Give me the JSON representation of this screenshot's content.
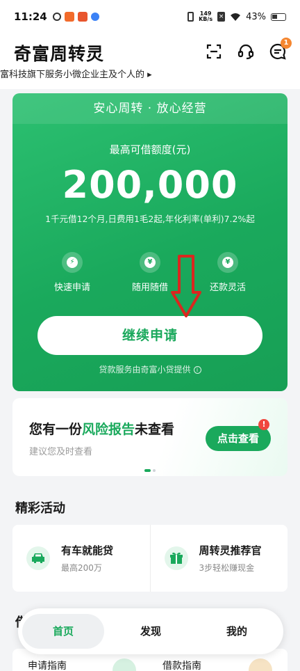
{
  "status_bar": {
    "time": "11:24",
    "net_speed_value": "149",
    "net_speed_unit": "KB/s",
    "battery": "43%"
  },
  "header": {
    "title": "奇富周转灵",
    "subtitle": "富科技旗下服务小微企业主及个人的 ▸",
    "notification_count": "1",
    "icons": [
      "scan-icon",
      "customer-service-icon",
      "message-icon"
    ]
  },
  "loan_card": {
    "slogan": "安心周转 · 放心经营",
    "limit_label": "最高可借额度(元)",
    "limit_amount": "200,000",
    "rate_text": "1千元借12个月,日费用1毛2起,年化利率(单利)7.2%起",
    "features": [
      {
        "label": "快速申请",
        "icon": "lightning-icon"
      },
      {
        "label": "随用随借",
        "icon": "wallet-icon"
      },
      {
        "label": "还款灵活",
        "icon": "money-bag-icon"
      }
    ],
    "continue_button": "继续申请",
    "provider_note": "贷款服务由奇富小贷提供"
  },
  "risk_card": {
    "title_prefix": "您有一份",
    "title_highlight": "风险报告",
    "title_suffix": "未查看",
    "subtitle": "建议您及时查看",
    "button": "点击查看",
    "alert": "!"
  },
  "activities": {
    "heading": "精彩活动",
    "items": [
      {
        "title": "有车就能贷",
        "subtitle": "最高200万",
        "icon": "car-icon"
      },
      {
        "title": "周转灵推荐官",
        "subtitle": "3步轻松赚现金",
        "icon": "gift-icon"
      }
    ]
  },
  "guides": {
    "heading_partial": "借",
    "items": [
      "申请指南",
      "借款指南"
    ]
  },
  "bottom_nav": {
    "items": [
      "首页",
      "发现",
      "我的"
    ],
    "active_index": 0
  },
  "colors": {
    "brand_green": "#1aa95c",
    "badge_orange": "#f5862f",
    "alert_red": "#f0473e",
    "overlay_arrow_red": "#d9271f"
  }
}
